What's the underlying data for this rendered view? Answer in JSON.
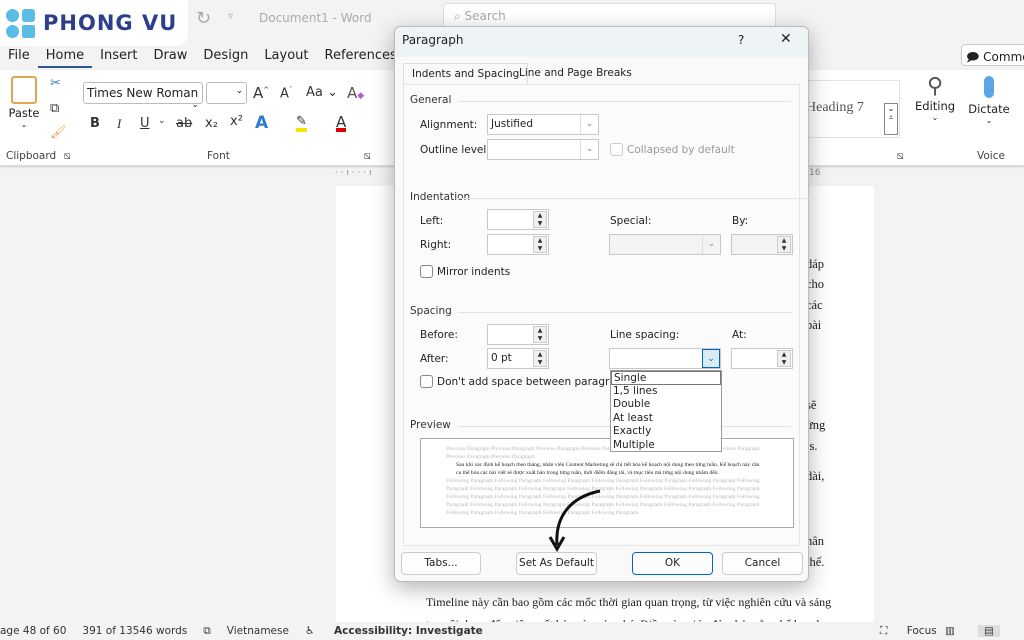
{
  "branding": {
    "logo_text": "PHONG VU"
  },
  "titlebar": {
    "document_title": "Document1  -  Word",
    "search_placeholder": "Search"
  },
  "menu": {
    "items": [
      "File",
      "Home",
      "Insert",
      "Draw",
      "Design",
      "Layout",
      "References"
    ],
    "active": "Home",
    "comments_label": "Comme"
  },
  "ribbon": {
    "paste_label": "Paste",
    "clipboard_label": "Clipboard",
    "font_label": "Font",
    "font_name": "Times New Roman",
    "font_size": "",
    "styles_visible": "Heading 7",
    "editing_label": "Editing",
    "dictate_label": "Dictate",
    "voice_label": "Voice",
    "buttons": {
      "bold": "B",
      "italic": "I",
      "underline": "U",
      "strike": "ab",
      "sub": "x₂",
      "sup": "x²",
      "grow": "A^",
      "shrink": "Aˇ",
      "case": "Aa"
    }
  },
  "ruler": {
    "marker": "16"
  },
  "document": {
    "right_fragments": [
      "dáp",
      "cho",
      "các",
      "bài",
      "sẽ",
      "ừng",
      "ls.",
      "dài,",
      "hân",
      "thể."
    ],
    "bottom_lines": [
      "Timeline này cần bao gồm các mốc thời gian quan trọng, từ việc nghiên cứu và sáng",
      "tạo nội dung đến việc xuất bản và quảng bá. Điều này giúp đảm bảo rằng kế hoạch"
    ]
  },
  "dialog": {
    "title": "Paragraph",
    "help": "?",
    "close": "✕",
    "tabs": [
      "Indents and Spacing",
      "Line and Page Breaks"
    ],
    "general": {
      "heading": "General",
      "alignment_label": "Alignment:",
      "alignment_value": "Justified",
      "outline_label": "Outline level:",
      "outline_value": "",
      "collapsed_label": "Collapsed by default"
    },
    "indentation": {
      "heading": "Indentation",
      "left_label": "Left:",
      "left_value": "",
      "right_label": "Right:",
      "right_value": "",
      "special_label": "Special:",
      "special_value": "",
      "by_label": "By:",
      "by_value": "",
      "mirror_label": "Mirror indents"
    },
    "spacing": {
      "heading": "Spacing",
      "before_label": "Before:",
      "before_value": "",
      "after_label": "After:",
      "after_value": "0 pt",
      "line_spacing_label": "Line spacing:",
      "line_spacing_value": "",
      "at_label": "At:",
      "at_value": "",
      "dont_add_label": "Don't add space between paragraphs o",
      "line_spacing_options": [
        "Single",
        "1,5 lines",
        "Double",
        "At least",
        "Exactly",
        "Multiple"
      ],
      "highlighted_option": "Single"
    },
    "preview": {
      "heading": "Preview",
      "previous": "Previous Paragraph Previous Paragraph Previous Paragraph Previous Paragraph Previous Paragraph Previous Paragraph Previous Paragraph Previous Paragraph Previous Paragraph",
      "current": "Sau khi xác định kế hoạch theo tháng, nhân viên Content Marketing sẽ chi tiết hóa kế hoạch nội dung theo từng tuần. Kế hoạch này cần cụ thể hóa các bài viết sẽ được xuất bản trong từng tuần, thời điểm đăng tải, và mục tiêu mà từng nội dung nhắm đến.",
      "following": "Following Paragraph Following Paragraph Following Paragraph Following Paragraph Following Paragraph Following Paragraph Following Paragraph Following Paragraph Following Paragraph Following Paragraph Following Paragraph Following Paragraph Following Paragraph Following Paragraph Following Paragraph Following Paragraph Following Paragraph Following Paragraph Following Paragraph Following Paragraph Following Paragraph Following Paragraph Following Paragraph Following Paragraph Following Paragraph Following Paragraph Following Paragraph Following Paragraph Following Paragraph Following Paragraph"
    },
    "buttons": {
      "tabs": "Tabs...",
      "set_default": "Set As Default",
      "ok": "OK",
      "cancel": "Cancel"
    }
  },
  "statusbar": {
    "page": "age 48 of 60",
    "words": "391 of 13546 words",
    "language": "Vietnamese",
    "accessibility": "Accessibility: Investigate",
    "focus": "Focus"
  },
  "colors": {
    "accent": "#2b579a",
    "logo_blue": "#2d3e8c",
    "logo_dots": "#5bbde6",
    "dropdown_focus": "#0067c0"
  }
}
